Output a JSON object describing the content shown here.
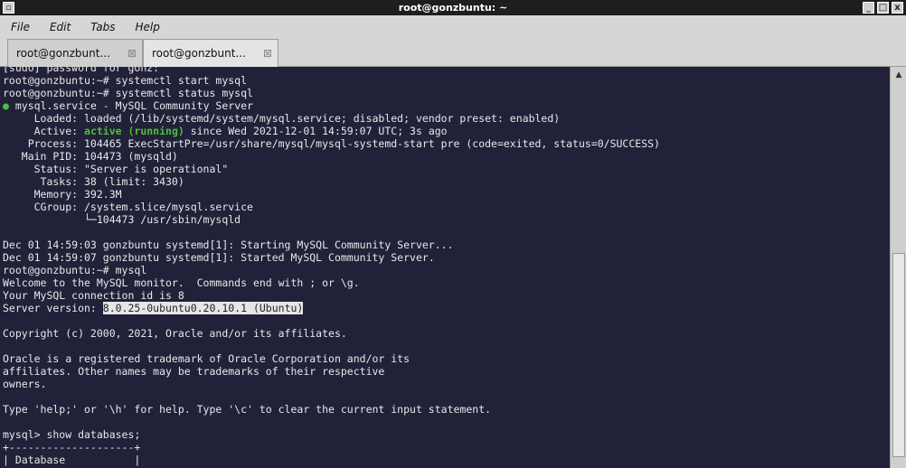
{
  "window": {
    "title": "root@gonzbuntu: ~",
    "menu_button": "▫",
    "minimize_button": "_",
    "maximize_button": "□",
    "close_button": "x"
  },
  "menu": [
    "File",
    "Edit",
    "Tabs",
    "Help"
  ],
  "tabs": [
    {
      "label": "root@gonzbunt...",
      "close": "⊠",
      "active": false
    },
    {
      "label": "root@gonzbunt...",
      "close": "⊠",
      "active": true
    }
  ],
  "terminal": {
    "lines": [
      "[sudo] password for gonz:",
      "root@gonzbuntu:~# systemctl start mysql",
      "root@gonzbuntu:~# systemctl status mysql",
      "mysql.service - MySQL Community Server",
      "     Loaded: loaded (/lib/systemd/system/mysql.service; disabled; vendor preset: enabled)",
      "     Active: ",
      "    Process: 104465 ExecStartPre=/usr/share/mysql/mysql-systemd-start pre (code=exited, status=0/SUCCESS)",
      "   Main PID: 104473 (mysqld)",
      "     Status: \"Server is operational\"",
      "      Tasks: 38 (limit: 3430)",
      "     Memory: 392.3M",
      "     CGroup: /system.slice/mysql.service",
      "             └─104473 /usr/sbin/mysqld",
      "",
      "Dec 01 14:59:03 gonzbuntu systemd[1]: Starting MySQL Community Server...",
      "Dec 01 14:59:07 gonzbuntu systemd[1]: Started MySQL Community Server.",
      "root@gonzbuntu:~# mysql",
      "Welcome to the MySQL monitor.  Commands end with ; or \\g.",
      "Your MySQL connection id is 8",
      "Server version: ",
      "",
      "Copyright (c) 2000, 2021, Oracle and/or its affiliates.",
      "",
      "Oracle is a registered trademark of Oracle Corporation and/or its",
      "affiliates. Other names may be trademarks of their respective",
      "owners.",
      "",
      "Type 'help;' or '\\h' for help. Type '\\c' to clear the current input statement.",
      "",
      "mysql> show databases;",
      "+--------------------+",
      "| Database           |"
    ],
    "status_dot": "●",
    "active_status": "active (running)",
    "active_suffix": " since Wed 2021-12-01 14:59:07 UTC; 3s ago",
    "server_version": "8.0.25-0ubuntu0.20.10.1 (Ubuntu)"
  },
  "scrollbar": {
    "up_arrow": "▲",
    "position_fraction": 0.98
  },
  "colors": {
    "terminal_bg": "#22213a",
    "terminal_fg": "#e8e8e8",
    "status_green": "#4cbf3a",
    "selection_bg": "#e6e6e6"
  }
}
